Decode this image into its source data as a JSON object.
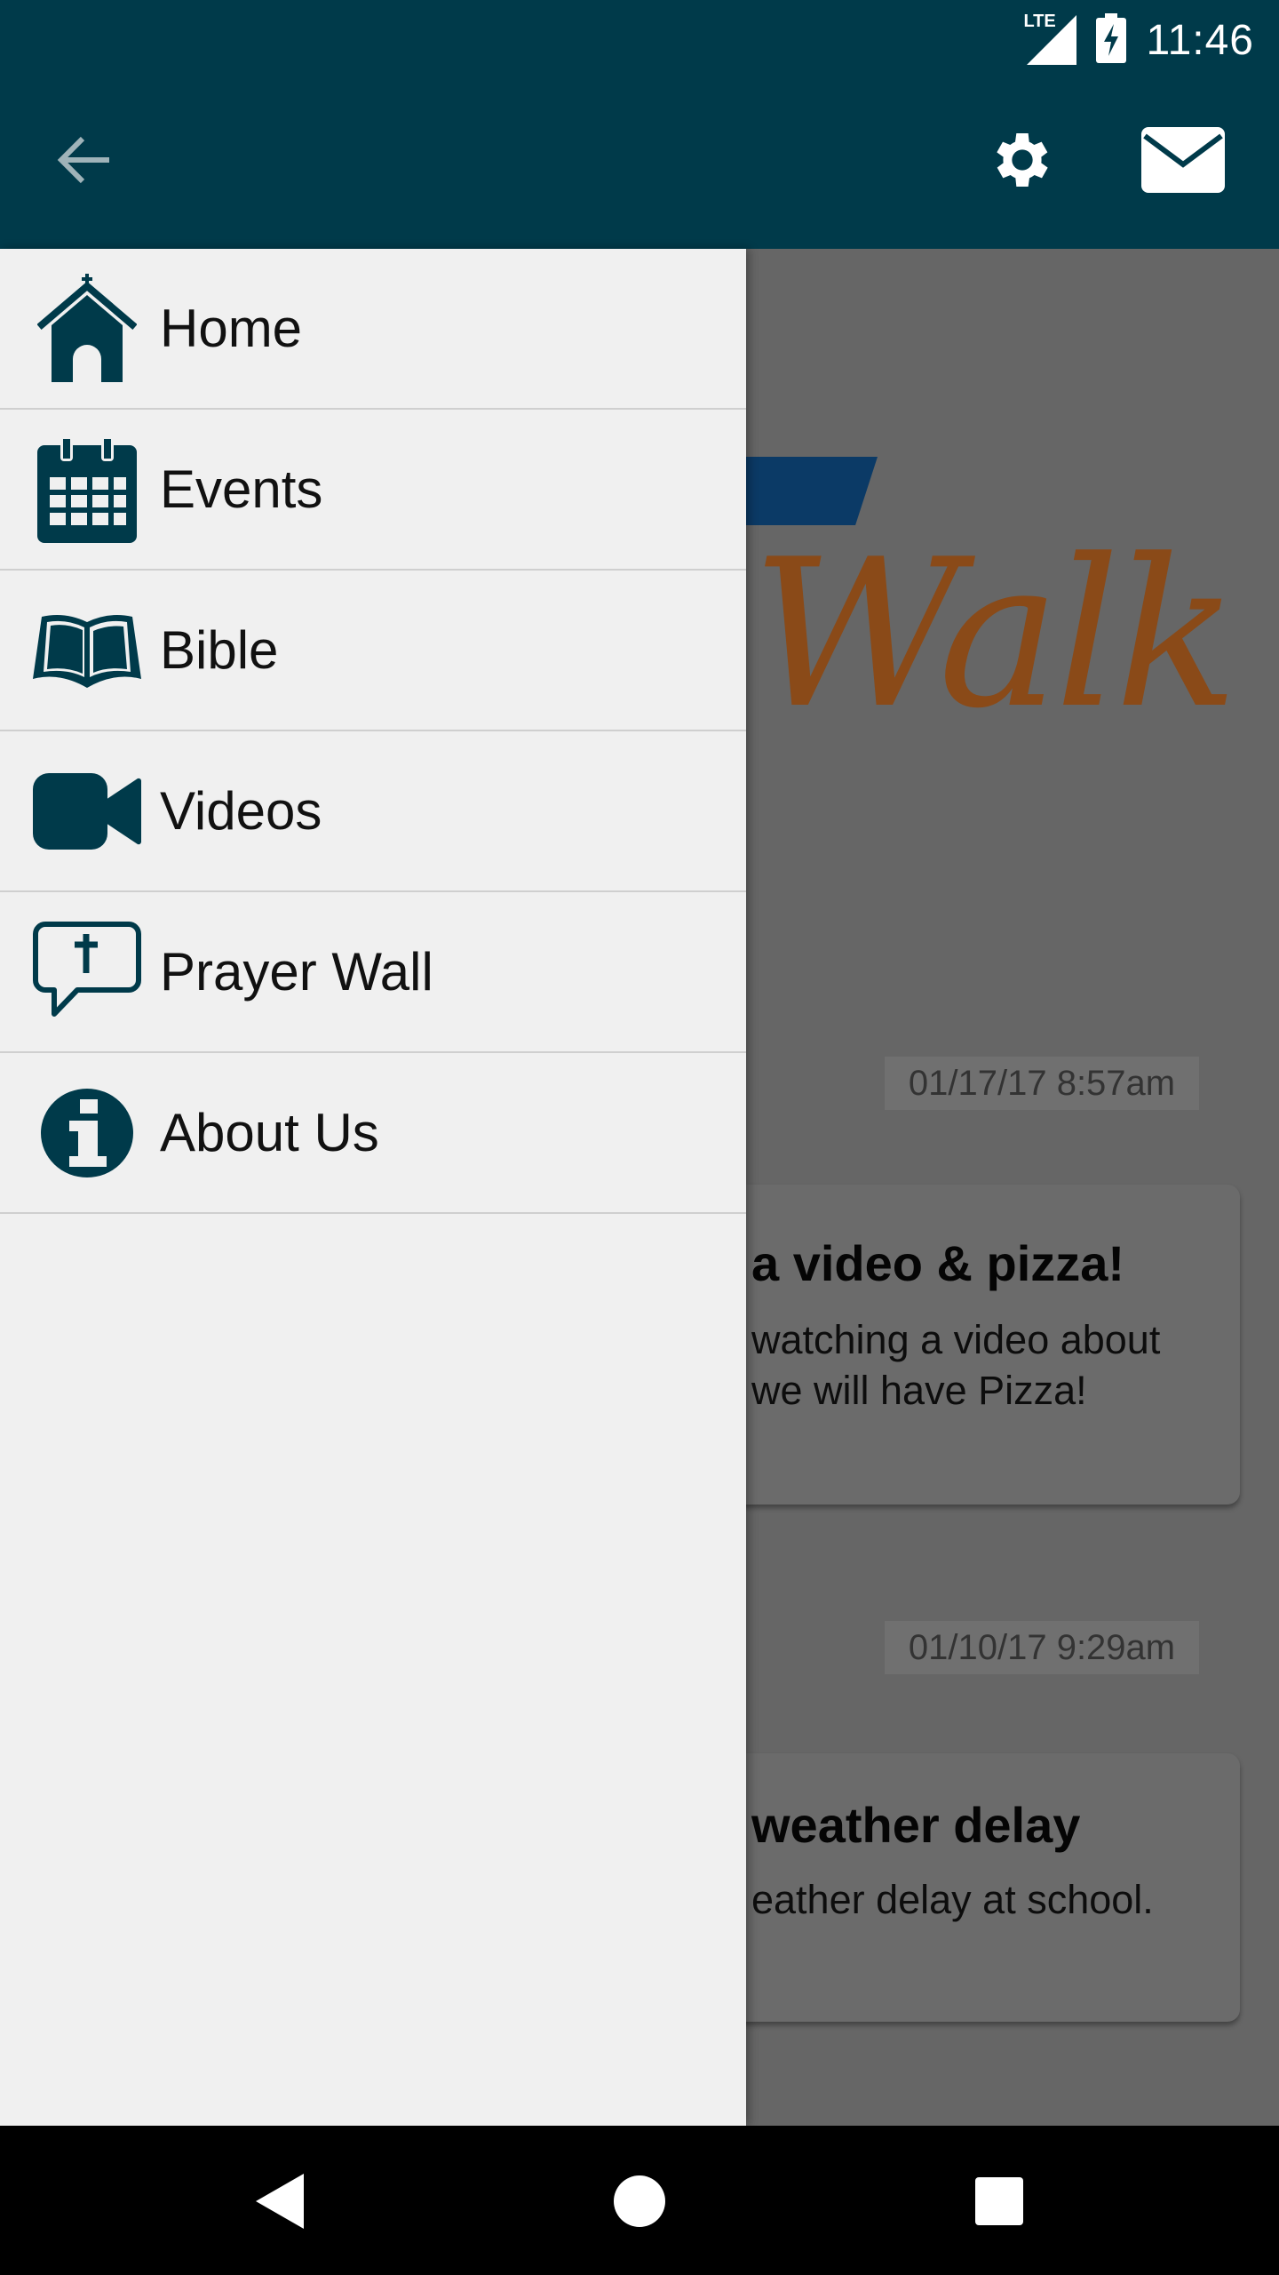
{
  "status_bar": {
    "network": "LTE",
    "time": "11:46"
  },
  "app_bar": {
    "back_icon": "arrow-left-icon",
    "settings_icon": "gear-icon",
    "mail_icon": "envelope-icon",
    "background_color": "#003a4a"
  },
  "drawer": {
    "items": [
      {
        "label": "Home",
        "icon": "church-icon"
      },
      {
        "label": "Events",
        "icon": "calendar-icon"
      },
      {
        "label": "Bible",
        "icon": "open-book-icon"
      },
      {
        "label": "Videos",
        "icon": "video-camera-icon"
      },
      {
        "label": "Prayer Wall",
        "icon": "speech-bubble-cross-icon"
      },
      {
        "label": "About Us",
        "icon": "info-icon"
      }
    ],
    "icon_color": "#003a4a"
  },
  "main": {
    "logo_text": "Walk",
    "posts": [
      {
        "date": "01/17/17 8:57am",
        "title": "a video & pizza!",
        "body": [
          "watching a video about",
          "we will have Pizza!"
        ]
      },
      {
        "date": "01/10/17 9:29am",
        "title": "weather delay",
        "body": [
          "eather delay at school."
        ]
      }
    ]
  },
  "nav_bar": {
    "back": "back-triangle-icon",
    "home": "home-circle-icon",
    "recents": "recents-square-icon"
  }
}
